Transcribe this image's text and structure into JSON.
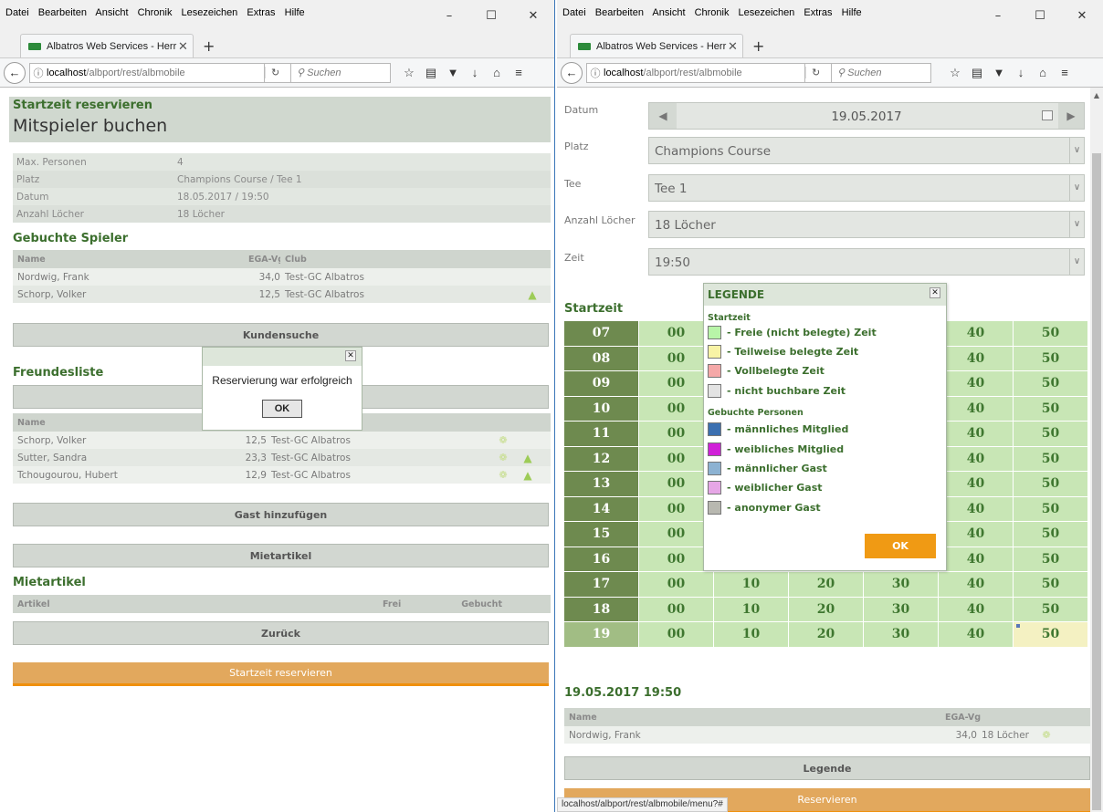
{
  "browser": {
    "menus": [
      "Datei",
      "Bearbeiten",
      "Ansicht",
      "Chronik",
      "Lesezeichen",
      "Extras",
      "Hilfe"
    ],
    "controls": {
      "minimize": "–",
      "maximize": "☐",
      "close": "✕"
    },
    "tab_title": "Albatros Web Services - Herr",
    "tab_close": "✕",
    "new_tab": "+",
    "url_host": "localhost",
    "url_path": "/albport/rest/albmobile",
    "search_placeholder": "Suchen",
    "status_url": "localhost/albport/rest/albmobile/menu?#"
  },
  "left": {
    "subtitle": "Startzeit reservieren",
    "title": "Mitspieler buchen",
    "info": [
      {
        "k": "Max. Personen",
        "v": "4"
      },
      {
        "k": "Platz",
        "v": "Champions Course / Tee 1"
      },
      {
        "k": "Datum",
        "v": "18.05.2017 / 19:50"
      },
      {
        "k": "Anzahl Löcher",
        "v": "18 Löcher"
      }
    ],
    "booked_title": "Gebuchte Spieler",
    "booked_headers": [
      "Name",
      "EGA-Vg",
      "Club"
    ],
    "booked": [
      {
        "name": "Nordwig, Frank",
        "hcp": "34,0",
        "club": "Test-GC Albatros"
      },
      {
        "name": "Schorp, Volker",
        "hcp": "12,5",
        "club": "Test-GC Albatros"
      }
    ],
    "btn_kundensuche": "Kundensuche",
    "friends_title": "Freundesliste",
    "friends_header": "Name",
    "friends": [
      {
        "name": "Schorp, Volker",
        "hcp": "12,5",
        "club": "Test-GC Albatros"
      },
      {
        "name": "Sutter, Sandra",
        "hcp": "23,3",
        "club": "Test-GC Albatros"
      },
      {
        "name": "Tchougourou, Hubert",
        "hcp": "12,9",
        "club": "Test-GC Albatros"
      }
    ],
    "btn_gast": "Gast hinzufügen",
    "btn_mietartikel": "Mietartikel",
    "rent_title": "Mietartikel",
    "rent_headers": [
      "Artikel",
      "Frei",
      "Gebucht"
    ],
    "btn_zurueck": "Zurück",
    "btn_reservieren": "Startzeit reservieren",
    "dialog_msg": "Reservierung war erfolgreich",
    "dialog_ok": "OK",
    "dialog_close": "✕"
  },
  "right": {
    "labels": {
      "datum": "Datum",
      "platz": "Platz",
      "tee": "Tee",
      "loecher": "Anzahl Löcher",
      "zeit": "Zeit"
    },
    "date": "19.05.2017",
    "platz": "Champions Course",
    "tee": "Tee 1",
    "loecher": "18 Löcher",
    "zeit": "19:50",
    "startzeit_title": "Startzeit",
    "hours": [
      "07",
      "08",
      "09",
      "10",
      "11",
      "12",
      "13",
      "14",
      "15",
      "16",
      "17",
      "18",
      "19"
    ],
    "minutes": [
      "00",
      "10",
      "20",
      "30",
      "40",
      "50"
    ],
    "selected_title": "19.05.2017 19:50",
    "sel_headers": [
      "Name",
      "EGA-Vg"
    ],
    "sel_row": {
      "name": "Nordwig, Frank",
      "hcp": "34,0",
      "holes": "18 Löcher"
    },
    "btn_legende": "Legende",
    "btn_reservieren": "Reservieren",
    "legend": {
      "title": "LEGENDE",
      "close": "✕",
      "sub1": "Startzeit",
      "items1": [
        {
          "label": "- Freie (nicht belegte) Zeit",
          "color": "#b8f5a8"
        },
        {
          "label": "- Teilweise belegte Zeit",
          "color": "#f8f3a5"
        },
        {
          "label": "- Vollbelegte Zeit",
          "color": "#f5a8a8"
        },
        {
          "label": "- nicht buchbare Zeit",
          "color": "#e3e3e3"
        }
      ],
      "sub2": "Gebuchte Personen",
      "items2": [
        {
          "label": "- männliches Mitglied",
          "color": "#3b6fb0"
        },
        {
          "label": "- weibliches Mitglied",
          "color": "#d020d8"
        },
        {
          "label": "- männlicher Gast",
          "color": "#8cb2d2"
        },
        {
          "label": "- weiblicher Gast",
          "color": "#e6a6e6"
        },
        {
          "label": "- anonymer Gast",
          "color": "#b8b8b0"
        }
      ],
      "ok": "OK"
    }
  }
}
